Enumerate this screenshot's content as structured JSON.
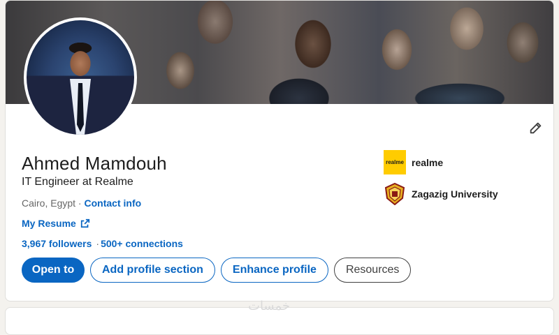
{
  "profile": {
    "name": "Ahmed Mamdouh",
    "headline": "IT Engineer at Realme",
    "location": "Cairo, Egypt",
    "location_sep": " · ",
    "contact_label": "Contact info",
    "resume_label": "My Resume",
    "followers": "3,967 followers",
    "connections_sep": "·",
    "connections": "500+ connections"
  },
  "actions": {
    "open_to": "Open to",
    "add_section": "Add profile section",
    "enhance": "Enhance profile",
    "resources": "Resources"
  },
  "organizations": [
    {
      "name": "realme",
      "logo_text": "realme",
      "logo_color": "#ffcc00"
    },
    {
      "name": "Zagazig University",
      "icon": "university-crest-icon"
    }
  ],
  "watermark": "خمسات",
  "colors": {
    "accent": "#0a66c2",
    "background": "#f4f2ee",
    "card": "#ffffff"
  },
  "icons": {
    "edit": "pencil-icon",
    "external_link": "external-link-icon"
  }
}
